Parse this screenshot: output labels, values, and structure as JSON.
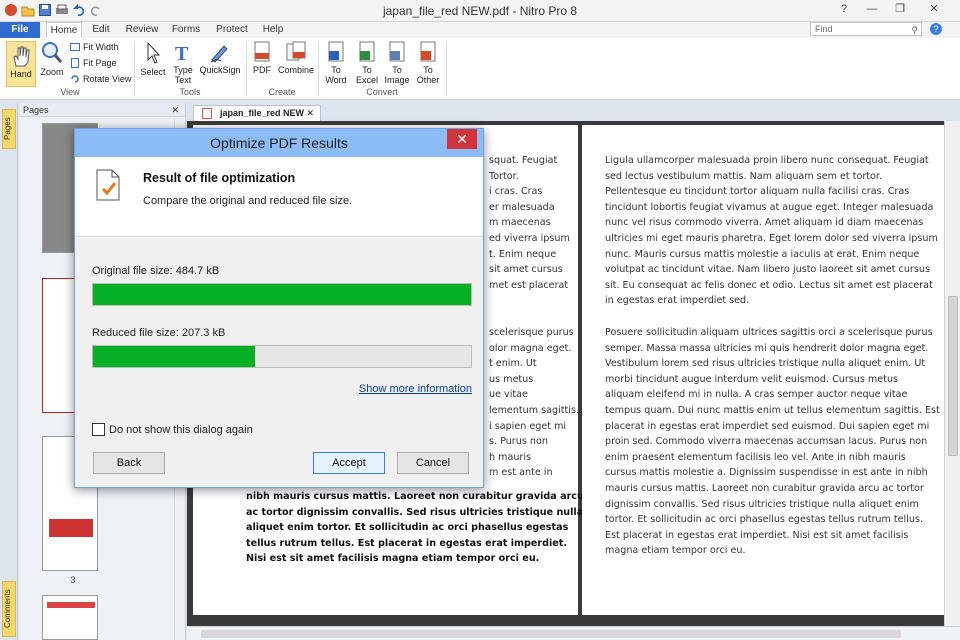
{
  "window": {
    "title": "japan_file_red NEW.pdf - Nitro Pro 8"
  },
  "ribbon_tabs": [
    "File",
    "Home",
    "Edit",
    "Review",
    "Forms",
    "Protect",
    "Help"
  ],
  "find": {
    "placeholder": "Find"
  },
  "ribbon": {
    "hand": "Hand",
    "zoom": "Zoom",
    "fit_width": "Fit Width",
    "fit_page": "Fit Page",
    "rotate_view": "Rotate View",
    "group_view": "View",
    "select": "Select",
    "type_text_1": "Type",
    "type_text_2": "Text",
    "quicksign": "QuickSign",
    "group_tools": "Tools",
    "pdf": "PDF",
    "combine": "Combine",
    "group_create": "Create",
    "to_word_1": "To",
    "to_word_2": "Word",
    "to_excel_1": "To",
    "to_excel_2": "Excel",
    "to_image_1": "To",
    "to_image_2": "Image",
    "to_other_1": "To",
    "to_other_2": "Other",
    "group_convert": "Convert"
  },
  "sidebar": {
    "pages_tab": "Pages",
    "comments_tab": "Comments",
    "panel_title": "Pages",
    "thumb_number": "3"
  },
  "document_tab": {
    "label": "japan_file_red NEW"
  },
  "dialog": {
    "title": "Optimize PDF Results",
    "heading": "Result of file optimization",
    "subheading": "Compare the original and reduced file size.",
    "original_label": "Original file size: 484.7 kB",
    "reduced_label": "Reduced file size: 207.3 kB",
    "original_fraction": 1.0,
    "reduced_fraction": 0.4277,
    "more_info": "Show more information",
    "checkbox_label": "Do not show this dialog again",
    "back": "Back",
    "accept": "Accept",
    "cancel": "Cancel"
  },
  "page_left_visible": {
    "p1": [
      "squat. Feugiat",
      "Tortor.",
      "i cras. Cras",
      "er malesuada",
      "m maecenas",
      "ed viverra ipsum",
      "t. Enim neque",
      "sit amet cursus",
      "met est placerat"
    ],
    "p2": [
      "scelerisque purus",
      "olor magna eget.",
      "t enim. Ut",
      "us metus",
      "ue vitae",
      "lementum sagittis. Est",
      "i sapien eget mi",
      "s. Purus non",
      "h mauris",
      "m est ante in"
    ],
    "p3_bold": [
      "nibh mauris cursus mattis. Laoreet non curabitur gravida arcu",
      "ac tortor dignissim convallis. Sed risus ultricies tristique nulla",
      "aliquet enim tortor. Et sollicitudin ac orci phasellus egestas",
      "tellus rutrum tellus. Est placerat in egestas erat imperdiet.",
      "Nisi est sit amet facilisis magna etiam tempor orci eu."
    ]
  },
  "page_right": {
    "p1": [
      "Ligula ullamcorper malesuada proin libero nunc consequat. Feugiat",
      "sed lectus vestibulum mattis. Nam aliquam sem et tortor.",
      "Pellentesque eu tincidunt tortor aliquam nulla facilisi cras. Cras",
      "tincidunt lobortis feugiat vivamus at augue eget. Integer malesuada",
      "nunc vel risus commodo viverra. Amet aliquam id diam maecenas",
      "ultricies mi eget mauris pharetra. Eget lorem dolor sed viverra ipsum",
      "nunc. Mauris cursus mattis molestie a iaculis at erat. Enim neque",
      "volutpat ac tincidunt vitae. Nam libero justo laoreet sit amet cursus",
      "sit. Eu consequat ac felis donec et odio. Lectus sit amet est placerat",
      "in egestas erat imperdiet sed."
    ],
    "p2": [
      "Posuere sollicitudin aliquam ultrices sagittis orci a scelerisque purus",
      "semper. Massa massa ultricies mi quis hendrerit dolor magna eget.",
      "Vestibulum lorem sed risus ultricies tristique nulla aliquet enim. Ut",
      "morbi tincidunt augue interdum velit euismod. Cursus metus",
      "aliquam eleifend mi in nulla. A cras semper auctor neque vitae",
      "tempus quam. Dui nunc mattis enim ut tellus elementum sagittis. Est",
      "placerat in egestas erat imperdiet sed euismod. Dui sapien eget mi",
      "proin sed. Commodo viverra maecenas accumsan lacus. Purus non",
      "enim praesent elementum facilisis leo vel. Ante in nibh mauris",
      "cursus mattis molestie a. Dignissim suspendisse in est ante in nibh",
      "mauris cursus mattis. Laoreet non curabitur gravida arcu ac tortor",
      "dignissim convallis. Sed risus ultricies tristique nulla aliquet enim",
      "tortor. Et sollicitudin ac orci phasellus egestas tellus rutrum tellus.",
      "Est placerat in egestas erat imperdiet. Nisi est sit amet facilisis",
      "magna etiam tempor orci eu."
    ]
  },
  "colors": {
    "accent": "#2f6bd1",
    "progress": "#06b025",
    "dialog_title": "#8cbcf5",
    "close": "#d0343a"
  }
}
